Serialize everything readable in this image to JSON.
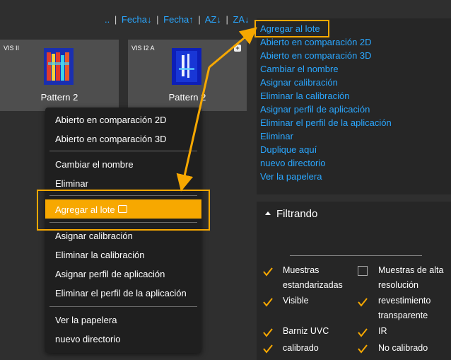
{
  "sort": {
    "up": "..",
    "fecha_desc": "Fecha↓",
    "fecha_asc": "Fecha↑",
    "az": "AZ↓",
    "za": "ZA↓",
    "sep": "|"
  },
  "cards": [
    {
      "tag": "VIS II",
      "name": "Pattern 2"
    },
    {
      "tag": "VIS I2 A",
      "name": "Pattern 2"
    }
  ],
  "context_menu": {
    "items_top": [
      "Abierto en comparación 2D",
      "Abierto en comparación 3D"
    ],
    "items_mid": [
      "Cambiar el nombre",
      "Eliminar"
    ],
    "highlight": "Agregar al lote",
    "items_bottom": [
      "Asignar calibración",
      "Eliminar la calibración",
      "Asignar perfil de aplicación",
      "Eliminar el perfil de la aplicación"
    ],
    "items_end": [
      "Ver la papelera",
      "nuevo directorio"
    ]
  },
  "right_menu": [
    "Agregar al lote",
    "Abierto en comparación 2D",
    "Abierto en comparación 3D",
    "Cambiar el nombre",
    "Asignar calibración",
    "Eliminar la calibración",
    "Asignar perfil de aplicación",
    "Eliminar el perfil de la aplicación",
    "Eliminar",
    "Duplique aquí",
    "nuevo directorio",
    "Ver la papelera"
  ],
  "filter": {
    "title": "Filtrando",
    "options": [
      {
        "label": "Muestras estandarizadas",
        "checked": true
      },
      {
        "label": "Muestras de alta resolución",
        "checked": false
      },
      {
        "label": "Visible",
        "checked": true
      },
      {
        "label": "revestimiento transparente",
        "checked": true
      },
      {
        "label": "Barniz UVC",
        "checked": true
      },
      {
        "label": "IR",
        "checked": true
      },
      {
        "label": "calibrado",
        "checked": true
      },
      {
        "label": "No calibrado",
        "checked": true
      }
    ]
  },
  "colors": {
    "accent": "#f7a800",
    "link": "#2aa7ff"
  }
}
